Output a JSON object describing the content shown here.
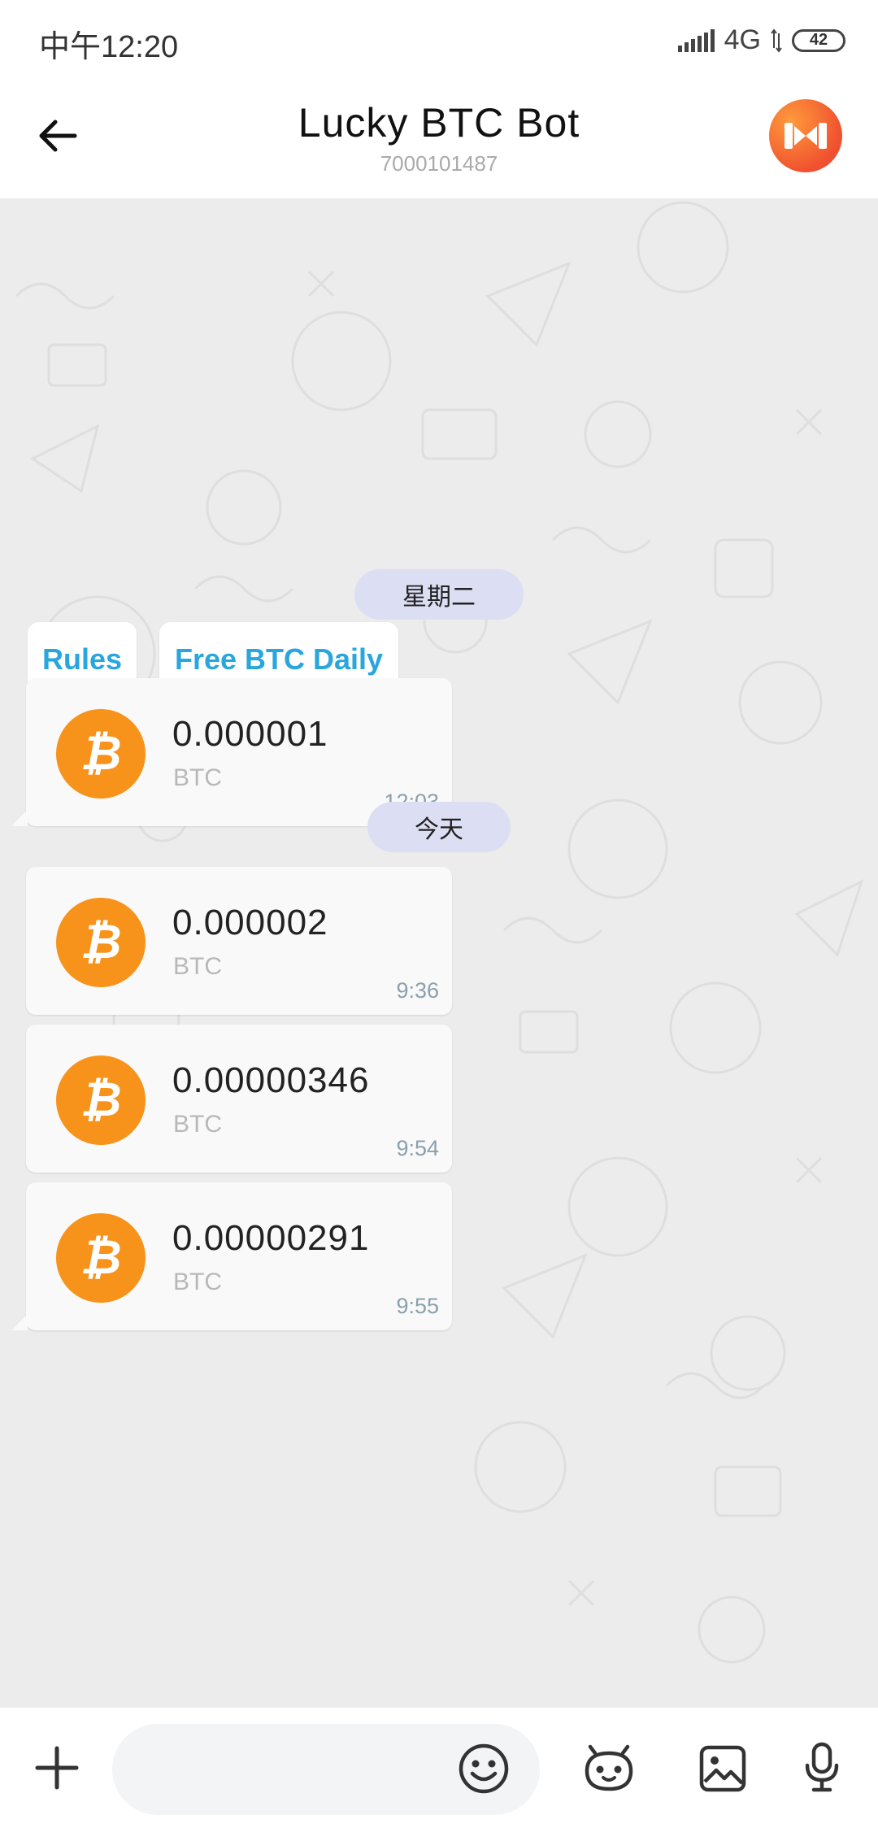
{
  "status_bar": {
    "time": "中午12:20",
    "network": "4G",
    "battery": "42"
  },
  "header": {
    "title": "Lucky BTC Bot",
    "subtitle": "7000101487",
    "back_icon": "arrow-left-icon",
    "avatar_icon": "bot-avatar-icon"
  },
  "chat": {
    "date_separators": [
      "星期二",
      "今天"
    ],
    "keyboard_buttons": [
      "Rules",
      "Free BTC Daily"
    ],
    "messages": [
      {
        "amount": "0.000001",
        "unit": "BTC",
        "time": "12:03"
      },
      {
        "amount": "0.000002",
        "unit": "BTC",
        "time": "9:36"
      },
      {
        "amount": "0.00000346",
        "unit": "BTC",
        "time": "9:54"
      },
      {
        "amount": "0.00000291",
        "unit": "BTC",
        "time": "9:55"
      }
    ]
  },
  "input_bar": {
    "placeholder": "",
    "icons": [
      "plus-icon",
      "emoji-icon",
      "bot-icon",
      "image-icon",
      "microphone-icon"
    ]
  },
  "colors": {
    "accent_blue": "#2aa6df",
    "btc_orange": "#f7931a",
    "date_pill": "#dcdff3",
    "chat_bg": "#ececec"
  }
}
